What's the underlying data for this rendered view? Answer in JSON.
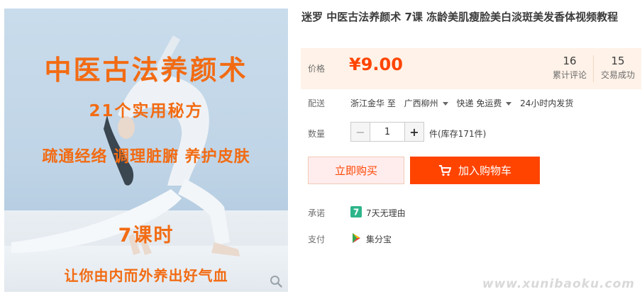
{
  "image": {
    "title": "中医古法养颜术",
    "subtitle1": "21个实用秘方",
    "subtitle2": "疏通经络 调理脏腑 养护皮肤",
    "subtitle3": "7课时",
    "subtitle4": "让你由内而外养出好气血"
  },
  "product": {
    "title": "迷罗 中医古法养颜术 7课 冻龄美肌瘦脸美白淡斑美发香体视频教程"
  },
  "price": {
    "label": "价格",
    "value": "¥9.00",
    "reviews_count": "16",
    "reviews_label": "累计评论",
    "sales_count": "15",
    "sales_label": "交易成功"
  },
  "delivery": {
    "label": "配送",
    "origin": "浙江金华 至",
    "destination": "广西柳州",
    "method": "快递 免运费",
    "ship_time": "24小时内发货"
  },
  "quantity": {
    "label": "数量",
    "value": "1",
    "minus": "−",
    "plus": "+",
    "stock": "件(库存171件)"
  },
  "actions": {
    "buy_now": "立即购买",
    "add_to_cart": "加入购物车"
  },
  "promise": {
    "label": "承诺",
    "text": "7天无理由"
  },
  "payment": {
    "label": "支付",
    "text": "集分宝"
  },
  "watermark": "www.xunibaoku.com",
  "colors": {
    "accent": "#ff4400",
    "image_text": "#f26b13",
    "price_bg": "#fff2e8"
  }
}
